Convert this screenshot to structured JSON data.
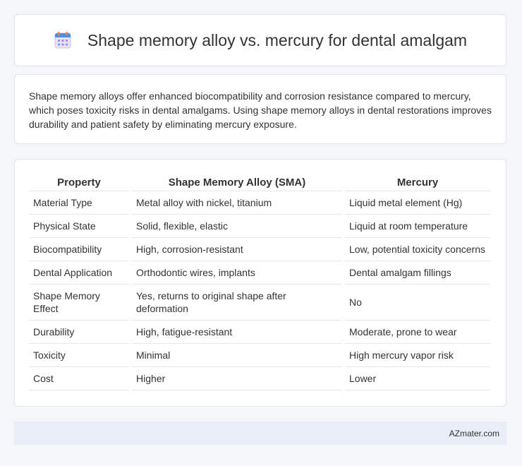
{
  "header": {
    "icon": "calendar-icon",
    "title": "Shape memory alloy vs. mercury for dental amalgam"
  },
  "summary": {
    "text": "Shape memory alloys offer enhanced biocompatibility and corrosion resistance compared to mercury, which poses toxicity risks in dental amalgams. Using shape memory alloys in dental restorations improves durability and patient safety by eliminating mercury exposure."
  },
  "table": {
    "headers": [
      "Property",
      "Shape Memory Alloy (SMA)",
      "Mercury"
    ],
    "rows": [
      [
        "Material Type",
        "Metal alloy with nickel, titanium",
        "Liquid metal element (Hg)"
      ],
      [
        "Physical State",
        "Solid, flexible, elastic",
        "Liquid at room temperature"
      ],
      [
        "Biocompatibility",
        "High, corrosion-resistant",
        "Low, potential toxicity concerns"
      ],
      [
        "Dental Application",
        "Orthodontic wires, implants",
        "Dental amalgam fillings"
      ],
      [
        "Shape Memory Effect",
        "Yes, returns to original shape after deformation",
        "No"
      ],
      [
        "Durability",
        "High, fatigue-resistant",
        "Moderate, prone to wear"
      ],
      [
        "Toxicity",
        "Minimal",
        "High mercury vapor risk"
      ],
      [
        "Cost",
        "Higher",
        "Lower"
      ]
    ]
  },
  "footer": {
    "brand": "AZmater.com"
  }
}
